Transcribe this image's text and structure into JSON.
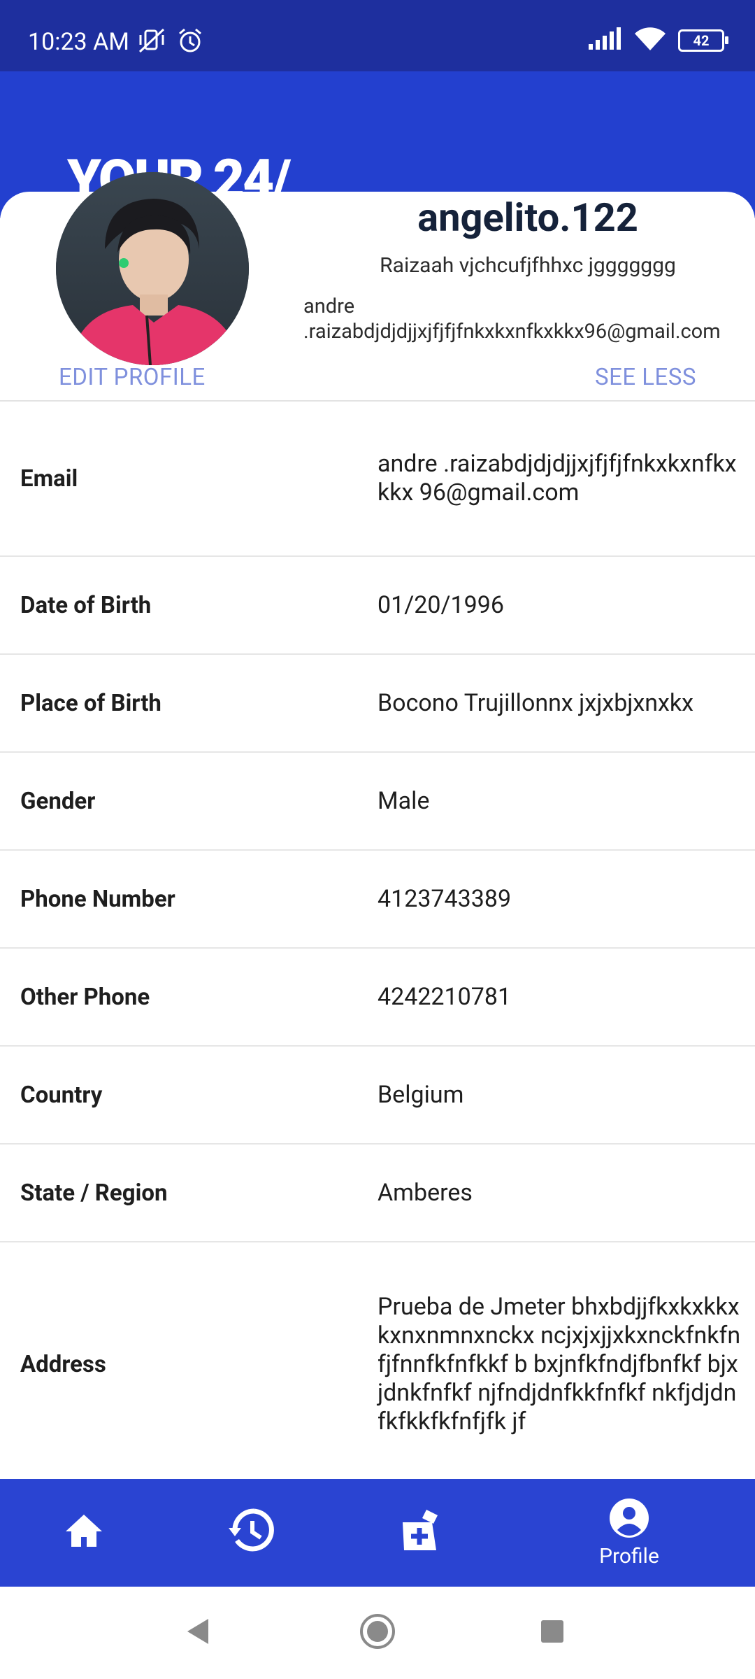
{
  "status_bar": {
    "time": "10:23 AM",
    "battery": "42",
    "icons": [
      "mute-vibrate-icon",
      "alarm-icon",
      "signal-icon",
      "wifi-icon",
      "battery-icon"
    ]
  },
  "banner": {
    "text": "YOUR 24/"
  },
  "profile": {
    "username": "angelito.122",
    "full_name": "Raizaah vjchcufjfhhxc jggggggg",
    "email_line1": "andre",
    "email_line2": ".raizabdjdjdjjxjfjfjfnkxkxnfkxkkx96@gmail.com",
    "edit_label": "EDIT PROFILE",
    "toggle_label": "SEE LESS"
  },
  "details": [
    {
      "label": "Email",
      "value": "andre .raizabdjdjdjjxjfjfjfnkxkxnfkxkkx 96@gmail.com"
    },
    {
      "label": "Date of Birth",
      "value": "01/20/1996"
    },
    {
      "label": "Place of Birth",
      "value": "Bocono Trujillonnx jxjxbjxnxkx"
    },
    {
      "label": "Gender",
      "value": "Male"
    },
    {
      "label": "Phone Number",
      "value": "4123743389"
    },
    {
      "label": "Other Phone",
      "value": "4242210781"
    },
    {
      "label": "Country",
      "value": "Belgium"
    },
    {
      "label": "State / Region",
      "value": "Amberes"
    },
    {
      "label": "Address",
      "value": "Prueba de Jmeter bhxbdjjfkxkxkkxkxnxnmnxnckx ncjxjxjjxkxnckfnkfnfjfnnfkfnfkkf b bxjnfkfndjfbnfkf bjxjdnkfnfkf njfndjdnfkkfnfkf nkfjdjdnfkfkkfkfnfjfk jf"
    }
  ],
  "bottom_nav": {
    "items": [
      {
        "icon": "home-icon",
        "label": ""
      },
      {
        "icon": "history-icon",
        "label": ""
      },
      {
        "icon": "medical-kit-icon",
        "label": ""
      },
      {
        "icon": "profile-icon",
        "label": "Profile"
      }
    ]
  },
  "colors": {
    "status_bar": "#1e2f9e",
    "banner": "#2340cf",
    "bottom_nav": "#2a44d2",
    "link": "#7f90dd"
  }
}
